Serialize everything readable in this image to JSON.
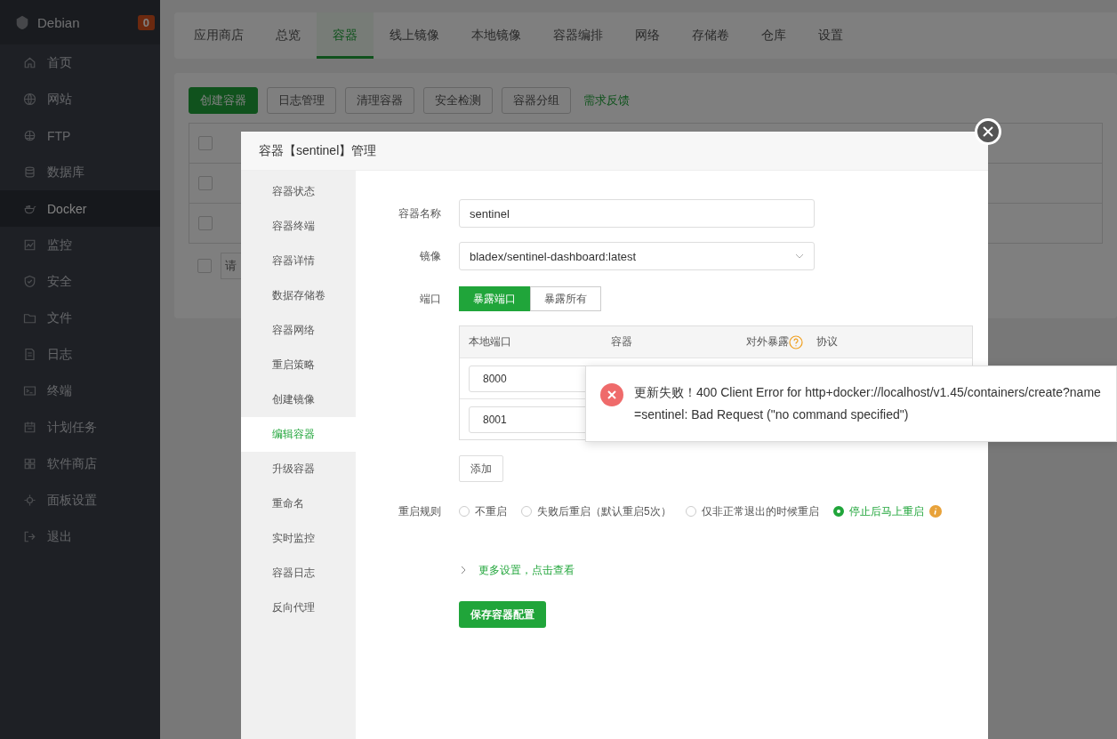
{
  "sidebar": {
    "title": "Debian",
    "badge": "0",
    "items": [
      {
        "label": "首页",
        "selected": false
      },
      {
        "label": "网站",
        "selected": false
      },
      {
        "label": "FTP",
        "selected": false
      },
      {
        "label": "数据库",
        "selected": false
      },
      {
        "label": "Docker",
        "selected": true
      },
      {
        "label": "监控",
        "selected": false
      },
      {
        "label": "安全",
        "selected": false
      },
      {
        "label": "文件",
        "selected": false
      },
      {
        "label": "日志",
        "selected": false
      },
      {
        "label": "终端",
        "selected": false
      },
      {
        "label": "计划任务",
        "selected": false
      },
      {
        "label": "软件商店",
        "selected": false
      },
      {
        "label": "面板设置",
        "selected": false
      },
      {
        "label": "退出",
        "selected": false
      }
    ]
  },
  "tabs": [
    {
      "label": "应用商店",
      "selected": false
    },
    {
      "label": "总览",
      "selected": false
    },
    {
      "label": "容器",
      "selected": true
    },
    {
      "label": "线上镜像",
      "selected": false
    },
    {
      "label": "本地镜像",
      "selected": false
    },
    {
      "label": "容器编排",
      "selected": false
    },
    {
      "label": "网络",
      "selected": false
    },
    {
      "label": "存储卷",
      "selected": false
    },
    {
      "label": "仓库",
      "selected": false
    },
    {
      "label": "设置",
      "selected": false
    }
  ],
  "toolbar": [
    {
      "label": "创建容器",
      "kind": "primary"
    },
    {
      "label": "日志管理",
      "kind": "default"
    },
    {
      "label": "清理容器",
      "kind": "default"
    },
    {
      "label": "安全检测",
      "kind": "default"
    },
    {
      "label": "容器分组",
      "kind": "default"
    },
    {
      "label": "需求反馈",
      "kind": "link"
    }
  ],
  "table": {
    "rows": [
      {
        "checked": false
      },
      {
        "checked": false
      },
      {
        "checked": false
      }
    ],
    "footer": {
      "checked": false,
      "placeholder": "请"
    }
  },
  "modal": {
    "title": "容器【sentinel】管理",
    "nav": [
      {
        "label": "容器状态",
        "selected": false
      },
      {
        "label": "容器终端",
        "selected": false
      },
      {
        "label": "容器详情",
        "selected": false
      },
      {
        "label": "数据存储卷",
        "selected": false
      },
      {
        "label": "容器网络",
        "selected": false
      },
      {
        "label": "重启策略",
        "selected": false
      },
      {
        "label": "创建镜像",
        "selected": false
      },
      {
        "label": "编辑容器",
        "selected": true
      },
      {
        "label": "升级容器",
        "selected": false
      },
      {
        "label": "重命名",
        "selected": false
      },
      {
        "label": "实时监控",
        "selected": false
      },
      {
        "label": "容器日志",
        "selected": false
      },
      {
        "label": "反向代理",
        "selected": false
      }
    ],
    "form": {
      "name": {
        "label": "容器名称",
        "value": "sentinel"
      },
      "image": {
        "label": "镜像",
        "value": "bladex/sentinel-dashboard:latest"
      },
      "ports": {
        "label": "端口",
        "modes": [
          {
            "label": "暴露端口",
            "selected": true
          },
          {
            "label": "暴露所有",
            "selected": false
          }
        ],
        "columns": [
          "本地端口",
          "容器",
          "对外暴露",
          "协议"
        ],
        "rows": [
          {
            "local": "8000"
          },
          {
            "local": "8001"
          }
        ],
        "add": "添加"
      },
      "restart": {
        "label": "重启规则",
        "options": [
          {
            "label": "不重启",
            "selected": false
          },
          {
            "label": "失败后重启（默认重启5次）",
            "selected": false
          },
          {
            "label": "仅非正常退出的时候重启",
            "selected": false
          },
          {
            "label": "停止后马上重启",
            "selected": true
          }
        ]
      },
      "more": "更多设置，点击查看",
      "save": "保存容器配置"
    }
  },
  "toast": {
    "message": "更新失败！400 Client Error for http+docker://localhost/v1.45/containers/create?name=sentinel: Bad Request (\"no command specified\")"
  }
}
